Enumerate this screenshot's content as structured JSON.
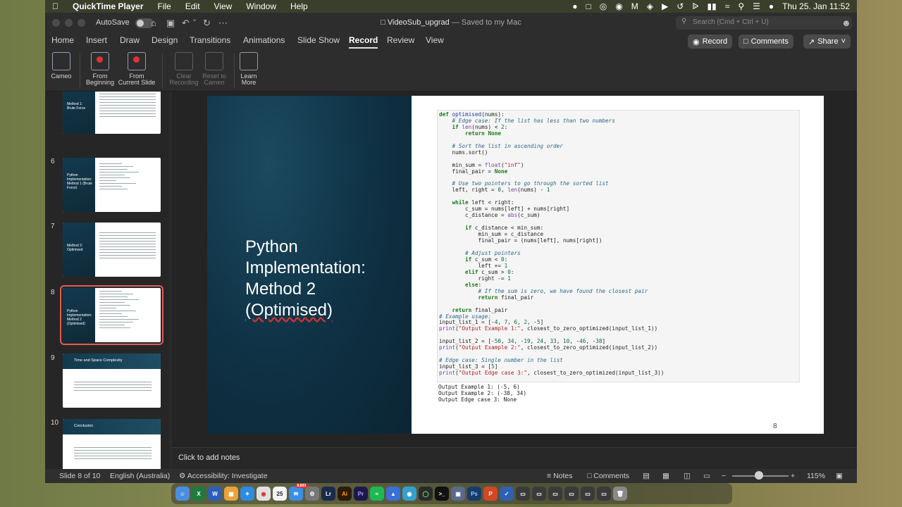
{
  "menubar": {
    "app_name": "QuickTime Player",
    "items": [
      "File",
      "Edit",
      "View",
      "Window",
      "Help"
    ],
    "datetime": "Thu 25. Jan  11:52"
  },
  "window": {
    "autosave_label": "AutoSave",
    "doc_name": "VideoSub_upgrad",
    "doc_status": " — Saved to my Mac",
    "search_placeholder": "Search (Cmd + Ctrl + U)"
  },
  "tabs": [
    "Home",
    "Insert",
    "Draw",
    "Design",
    "Transitions",
    "Animations",
    "Slide Show",
    "Record",
    "Review",
    "View"
  ],
  "active_tab": "Record",
  "top_buttons": {
    "record": "Record",
    "comments": "Comments",
    "share": "Share"
  },
  "ribbon": {
    "cameo": "Cameo",
    "from_beginning": [
      "From",
      "Beginning"
    ],
    "from_current": [
      "From",
      "Current Slide"
    ],
    "clear_recording": [
      "Clear",
      "Recording"
    ],
    "reset_cameo": [
      "Reset to",
      "Cameo"
    ],
    "learn_more": [
      "Learn",
      "More"
    ]
  },
  "thumbnails": [
    {
      "number": "",
      "title": "Method 1:\nBrute Force"
    },
    {
      "number": "6",
      "title": "Python\nImplementation:\nMethod 1 (Brute\nForce)"
    },
    {
      "number": "7",
      "title": "Method 2:\nOptimised"
    },
    {
      "number": "8",
      "title": "Python\nImplementation:\nMethod 2\n(Optimised)"
    },
    {
      "number": "9",
      "title": "Time and Space Complexity"
    },
    {
      "number": "10",
      "title": "Conclusion"
    }
  ],
  "slide": {
    "title_lines": [
      "Python",
      "Implementation:",
      "Method 2",
      "(Optimised)"
    ],
    "page_number": "8",
    "code_lines": [
      "def optimised(nums):",
      "    # Edge case: If the list has less than two numbers",
      "    if len(nums) < 2:",
      "        return None",
      "",
      "    # Sort the list in ascending order",
      "    nums.sort()",
      "",
      "    min_sum = float(\"inf\")",
      "    final_pair = None",
      "",
      "    # Use two pointers to go through the sorted list",
      "    left, right = 0, len(nums) - 1",
      "",
      "    while left < right:",
      "        c_sum = nums[left] + nums[right]",
      "        c_distance = abs(c_sum)",
      "",
      "        if c_distance < min_sum:",
      "            min_sum = c_distance",
      "            final_pair = (nums[left], nums[right])",
      "",
      "        # Adjust pointers",
      "        if c_sum < 0:",
      "            left += 1",
      "        elif c_sum > 0:",
      "            right -= 1",
      "        else:",
      "            # If the sum is zero, we have found the closest pair",
      "            return final_pair",
      "",
      "    return final_pair",
      "# Example usage:",
      "input_list_1 = [-4, 7, 6, 2, -5]",
      "print(\"Output Example 1:\", closest_to_zero_optimized(input_list_1))",
      "",
      "input_list_2 = [-50, 34, -19, 24, 33, 10, -46, -38]",
      "print(\"Output Example 2:\", closest_to_zero_optimized(input_list_2))",
      "",
      "# Edge case: Single number in the list",
      "input_list_3 = [5]",
      "print(\"Output Edge case 3:\", closest_to_zero_optimized(input_list_3))"
    ],
    "output_lines": [
      "Output Example 1: (-5, 6)",
      "Output Example 2: (-38, 34)",
      "Output Edge case 3: None"
    ]
  },
  "notes_placeholder": "Click to add notes",
  "status": {
    "slide_info": "Slide 8 of 10",
    "language": "English (Australia)",
    "accessibility": "Accessibility: Investigate",
    "notes": "Notes",
    "comments": "Comments",
    "zoom": "115%",
    "zoom_level": 0.48
  },
  "dock": {
    "calendar_day": "25",
    "mail_badge": "8,693"
  },
  "colors": {
    "accent_red": "#e05a5a",
    "slide_dark": "#0f3245",
    "keyword": "#1b7a1b",
    "comment": "#2d6b8a",
    "string": "#b22222"
  }
}
